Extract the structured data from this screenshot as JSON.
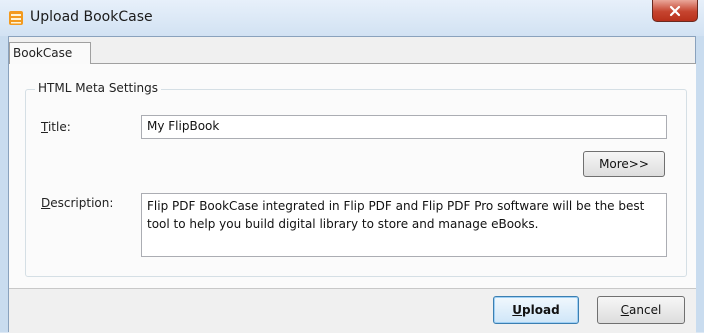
{
  "window": {
    "title": "Upload BookCase",
    "close_label": "x"
  },
  "tabs": [
    {
      "label": "BookCase"
    }
  ],
  "meta_group": {
    "legend": "HTML Meta Settings",
    "title_label_prefix": "",
    "title_label_mnemonic": "T",
    "title_label_rest": "itle:",
    "title_value": "My FlipBook",
    "more_button": "More>>",
    "description_label_mnemonic": "D",
    "description_label_rest": "escription:",
    "description_value": "Flip PDF BookCase integrated in Flip PDF and Flip PDF Pro software will be the best tool to help you build digital library to store and manage eBooks."
  },
  "footer": {
    "upload_mnemonic": "U",
    "upload_rest": "pload",
    "cancel_mnemonic": "C",
    "cancel_rest": "ancel"
  },
  "colors": {
    "titlebar": "#d2e2f3",
    "close_button": "#c6442f",
    "default_button_border": "#3c7fb1"
  },
  "icons": {
    "app": "bookcase-icon",
    "close": "close-icon"
  }
}
